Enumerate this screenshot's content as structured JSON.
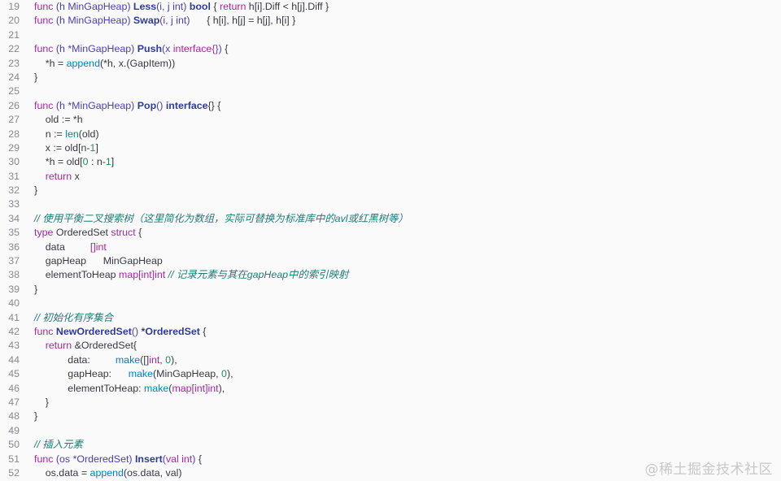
{
  "watermark": "@稀土掘金技术社区",
  "lines": [
    {
      "n": "19",
      "tokens": [
        [
          "kw",
          "func "
        ],
        [
          "type",
          "(h MinGapHeap) "
        ],
        [
          "fn",
          "Less"
        ],
        [
          "type",
          "(i, j int) "
        ],
        [
          "fn",
          "bool"
        ],
        [
          "plain",
          " { "
        ],
        [
          "kw",
          "return "
        ],
        [
          "plain",
          "h[i].Diff < h[j].Diff }"
        ]
      ]
    },
    {
      "n": "20",
      "tokens": [
        [
          "kw",
          "func "
        ],
        [
          "type",
          "(h MinGapHeap) "
        ],
        [
          "fn",
          "Swap"
        ],
        [
          "type",
          "(i, j int)      "
        ],
        [
          "plain",
          "{ h[i], h[j] = h[j], h[i] }"
        ]
      ]
    },
    {
      "n": "21",
      "tokens": []
    },
    {
      "n": "22",
      "tokens": [
        [
          "kw",
          "func "
        ],
        [
          "type",
          "(h *MinGapHeap) "
        ],
        [
          "fn",
          "Push"
        ],
        [
          "type",
          "(x "
        ],
        [
          "kw",
          "interface{}"
        ],
        [
          "type",
          ") "
        ],
        [
          "plain",
          "{"
        ]
      ]
    },
    {
      "n": "23",
      "tokens": [
        [
          "plain",
          "    *h = "
        ],
        [
          "call",
          "append"
        ],
        [
          "plain",
          "(*h, x.(GapItem))"
        ]
      ]
    },
    {
      "n": "24",
      "tokens": [
        [
          "plain",
          "}"
        ]
      ]
    },
    {
      "n": "25",
      "tokens": []
    },
    {
      "n": "26",
      "tokens": [
        [
          "kw",
          "func "
        ],
        [
          "type",
          "(h *MinGapHeap) "
        ],
        [
          "fn",
          "Pop"
        ],
        [
          "type",
          "() "
        ],
        [
          "fn",
          "interface"
        ],
        [
          "plain",
          "{} {"
        ]
      ]
    },
    {
      "n": "27",
      "tokens": [
        [
          "plain",
          "    old := *h"
        ]
      ]
    },
    {
      "n": "28",
      "tokens": [
        [
          "plain",
          "    n := "
        ],
        [
          "call",
          "len"
        ],
        [
          "plain",
          "(old)"
        ]
      ]
    },
    {
      "n": "29",
      "tokens": [
        [
          "plain",
          "    x := old[n-"
        ],
        [
          "num",
          "1"
        ],
        [
          "plain",
          "]"
        ]
      ]
    },
    {
      "n": "30",
      "tokens": [
        [
          "plain",
          "    *h = old["
        ],
        [
          "num",
          "0"
        ],
        [
          "plain",
          " : n-"
        ],
        [
          "num",
          "1"
        ],
        [
          "plain",
          "]"
        ]
      ]
    },
    {
      "n": "31",
      "tokens": [
        [
          "kw",
          "    return "
        ],
        [
          "plain",
          "x"
        ]
      ]
    },
    {
      "n": "32",
      "tokens": [
        [
          "plain",
          "}"
        ]
      ]
    },
    {
      "n": "33",
      "tokens": []
    },
    {
      "n": "34",
      "tokens": [
        [
          "cm",
          "// 使用平衡二叉搜索树（这里简化为数组，实际可替换为标准库中的avl或红黑树等）"
        ]
      ]
    },
    {
      "n": "35",
      "tokens": [
        [
          "kw",
          "type "
        ],
        [
          "plain",
          "OrderedSet "
        ],
        [
          "kw",
          "struct "
        ],
        [
          "plain",
          "{"
        ]
      ]
    },
    {
      "n": "36",
      "tokens": [
        [
          "plain",
          "    data         "
        ],
        [
          "kw",
          "[]int"
        ]
      ]
    },
    {
      "n": "37",
      "tokens": [
        [
          "plain",
          "    gapHeap      MinGapHeap"
        ]
      ]
    },
    {
      "n": "38",
      "tokens": [
        [
          "plain",
          "    elementToHeap "
        ],
        [
          "kw",
          "map[int]int"
        ],
        [
          "cm",
          " // 记录元素与其在gapHeap中的索引映射"
        ]
      ]
    },
    {
      "n": "39",
      "tokens": [
        [
          "plain",
          "}"
        ]
      ]
    },
    {
      "n": "40",
      "tokens": []
    },
    {
      "n": "41",
      "tokens": [
        [
          "cm",
          "// 初始化有序集合"
        ]
      ]
    },
    {
      "n": "42",
      "tokens": [
        [
          "kw",
          "func "
        ],
        [
          "fn",
          "NewOrderedSet"
        ],
        [
          "type",
          "() "
        ],
        [
          "fn",
          "*OrderedSet"
        ],
        [
          "plain",
          " {"
        ]
      ]
    },
    {
      "n": "43",
      "tokens": [
        [
          "kw",
          "    return "
        ],
        [
          "plain",
          "&OrderedSet{"
        ]
      ]
    },
    {
      "n": "44",
      "tokens": [
        [
          "plain",
          "            data:         "
        ],
        [
          "call",
          "make"
        ],
        [
          "plain",
          "([]"
        ],
        [
          "kw",
          "int"
        ],
        [
          "plain",
          ", "
        ],
        [
          "num",
          "0"
        ],
        [
          "plain",
          "),"
        ]
      ]
    },
    {
      "n": "45",
      "tokens": [
        [
          "plain",
          "            gapHeap:      "
        ],
        [
          "call",
          "make"
        ],
        [
          "plain",
          "(MinGapHeap, "
        ],
        [
          "num",
          "0"
        ],
        [
          "plain",
          "),"
        ]
      ]
    },
    {
      "n": "46",
      "tokens": [
        [
          "plain",
          "            elementToHeap: "
        ],
        [
          "call",
          "make"
        ],
        [
          "plain",
          "("
        ],
        [
          "kw",
          "map[int]int"
        ],
        [
          "plain",
          "),"
        ]
      ]
    },
    {
      "n": "47",
      "tokens": [
        [
          "plain",
          "    }"
        ]
      ]
    },
    {
      "n": "48",
      "tokens": [
        [
          "plain",
          "}"
        ]
      ]
    },
    {
      "n": "49",
      "tokens": []
    },
    {
      "n": "50",
      "tokens": [
        [
          "cm",
          "// 插入元素"
        ]
      ]
    },
    {
      "n": "51",
      "tokens": [
        [
          "kw",
          "func "
        ],
        [
          "type",
          "(os *OrderedSet) "
        ],
        [
          "fn",
          "Insert"
        ],
        [
          "type",
          "("
        ],
        [
          "kw",
          "val int"
        ],
        [
          "type",
          ") "
        ],
        [
          "plain",
          "{"
        ]
      ]
    },
    {
      "n": "52",
      "tokens": [
        [
          "plain",
          "    os.data = "
        ],
        [
          "call",
          "append"
        ],
        [
          "plain",
          "(os.data, val)"
        ]
      ]
    }
  ]
}
